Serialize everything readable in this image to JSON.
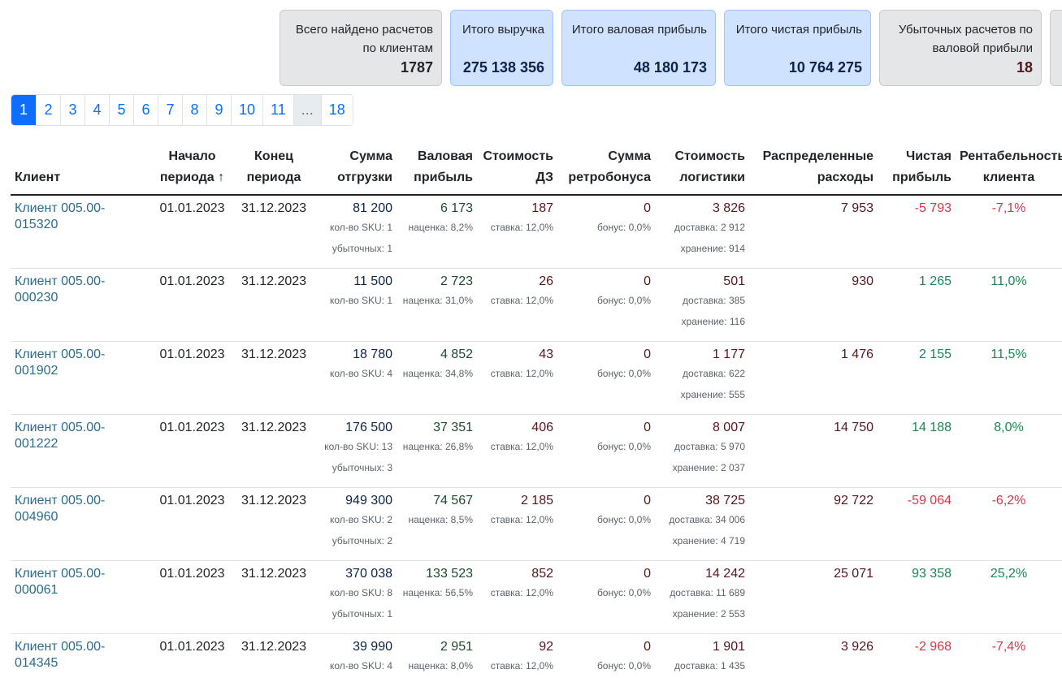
{
  "summary": {
    "cards": [
      {
        "title": "Всего найдено расчетов по клиентам",
        "value": "1787",
        "style": "gray"
      },
      {
        "title": "Итого выручка",
        "value": "275 138 356",
        "style": "blue"
      },
      {
        "title": "Итого валовая прибыль",
        "value": "48 180 173",
        "style": "blue"
      },
      {
        "title": "Итого чистая прибыль",
        "value": "10 764 275",
        "style": "blue"
      },
      {
        "title": "Убыточных расчетов по валовой прибыли",
        "value": "18",
        "style": "gray"
      }
    ]
  },
  "pagination": {
    "pages": [
      "1",
      "2",
      "3",
      "4",
      "5",
      "6",
      "7",
      "8",
      "9",
      "10",
      "11",
      "...",
      "18"
    ],
    "active": "1"
  },
  "table": {
    "headers": {
      "client": "Клиент",
      "start": "Начало периода ↑",
      "end": "Конец периода",
      "shipment": "Сумма отгрузки",
      "gross": "Валовая прибыль",
      "dz": "Стоимость ДЗ",
      "retro": "Сумма ретробонуса",
      "logistics": "Стоимость логистики",
      "distributed": "Распределенные расходы",
      "net": "Чистая прибыль",
      "profitability": "Рентабельность клиента"
    },
    "rows": [
      {
        "client": "Клиент 005.00-015320",
        "start": "01.01.2023",
        "end": "31.12.2023",
        "shipment": "81 200",
        "sku": "кол-во SKU: 1",
        "loss": "убыточных: 1",
        "gross": "6 173",
        "markup": "наценка: 8,2%",
        "dz": "187",
        "rate": "ставка: 12,0%",
        "retro": "0",
        "bonus": "бонус: 0,0%",
        "logistics": "3 826",
        "delivery": "доставка: 2 912",
        "storage": "хранение: 914",
        "distributed": "7 953",
        "net": "-5 793",
        "profitability": "-7,1%"
      },
      {
        "client": "Клиент 005.00-000230",
        "start": "01.01.2023",
        "end": "31.12.2023",
        "shipment": "11 500",
        "sku": "кол-во SKU: 1",
        "loss": "",
        "gross": "2 723",
        "markup": "наценка: 31,0%",
        "dz": "26",
        "rate": "ставка: 12,0%",
        "retro": "0",
        "bonus": "бонус: 0,0%",
        "logistics": "501",
        "delivery": "доставка: 385",
        "storage": "хранение: 116",
        "distributed": "930",
        "net": "1 265",
        "profitability": "11,0%"
      },
      {
        "client": "Клиент 005.00-001902",
        "start": "01.01.2023",
        "end": "31.12.2023",
        "shipment": "18 780",
        "sku": "кол-во SKU: 4",
        "loss": "",
        "gross": "4 852",
        "markup": "наценка: 34,8%",
        "dz": "43",
        "rate": "ставка: 12,0%",
        "retro": "0",
        "bonus": "бонус: 0,0%",
        "logistics": "1 177",
        "delivery": "доставка: 622",
        "storage": "хранение: 555",
        "distributed": "1 476",
        "net": "2 155",
        "profitability": "11,5%"
      },
      {
        "client": "Клиент 005.00-001222",
        "start": "01.01.2023",
        "end": "31.12.2023",
        "shipment": "176 500",
        "sku": "кол-во SKU: 13",
        "loss": "убыточных: 3",
        "gross": "37 351",
        "markup": "наценка: 26,8%",
        "dz": "406",
        "rate": "ставка: 12,0%",
        "retro": "0",
        "bonus": "бонус: 0,0%",
        "logistics": "8 007",
        "delivery": "доставка: 5 970",
        "storage": "хранение: 2 037",
        "distributed": "14 750",
        "net": "14 188",
        "profitability": "8,0%"
      },
      {
        "client": "Клиент 005.00-004960",
        "start": "01.01.2023",
        "end": "31.12.2023",
        "shipment": "949 300",
        "sku": "кол-во SKU: 2",
        "loss": "убыточных: 2",
        "gross": "74 567",
        "markup": "наценка: 8,5%",
        "dz": "2 185",
        "rate": "ставка: 12,0%",
        "retro": "0",
        "bonus": "бонус: 0,0%",
        "logistics": "38 725",
        "delivery": "доставка: 34 006",
        "storage": "хранение: 4 719",
        "distributed": "92 722",
        "net": "-59 064",
        "profitability": "-6,2%"
      },
      {
        "client": "Клиент 005.00-000061",
        "start": "01.01.2023",
        "end": "31.12.2023",
        "shipment": "370 038",
        "sku": "кол-во SKU: 8",
        "loss": "убыточных: 1",
        "gross": "133 523",
        "markup": "наценка: 56,5%",
        "dz": "852",
        "rate": "ставка: 12,0%",
        "retro": "0",
        "bonus": "бонус: 0,0%",
        "logistics": "14 242",
        "delivery": "доставка: 11 689",
        "storage": "хранение: 2 553",
        "distributed": "25 071",
        "net": "93 358",
        "profitability": "25,2%"
      },
      {
        "client": "Клиент 005.00-014345",
        "start": "01.01.2023",
        "end": "31.12.2023",
        "shipment": "39 990",
        "sku": "кол-во SKU: 4",
        "loss": "",
        "gross": "2 951",
        "markup": "наценка: 8,0%",
        "dz": "92",
        "rate": "ставка: 12,0%",
        "retro": "0",
        "bonus": "бонус: 0,0%",
        "logistics": "1 901",
        "delivery": "доставка: 1 435",
        "storage": "",
        "distributed": "3 926",
        "net": "-2 968",
        "profitability": "-7,4%"
      }
    ]
  },
  "colors": {
    "accent": "#0d6efd",
    "card_blue_bg": "#cfe2ff",
    "card_gray_bg": "#e5e6e8",
    "client_link": "#2b6c8a",
    "negative": "#dc3545",
    "positive": "#198754"
  }
}
